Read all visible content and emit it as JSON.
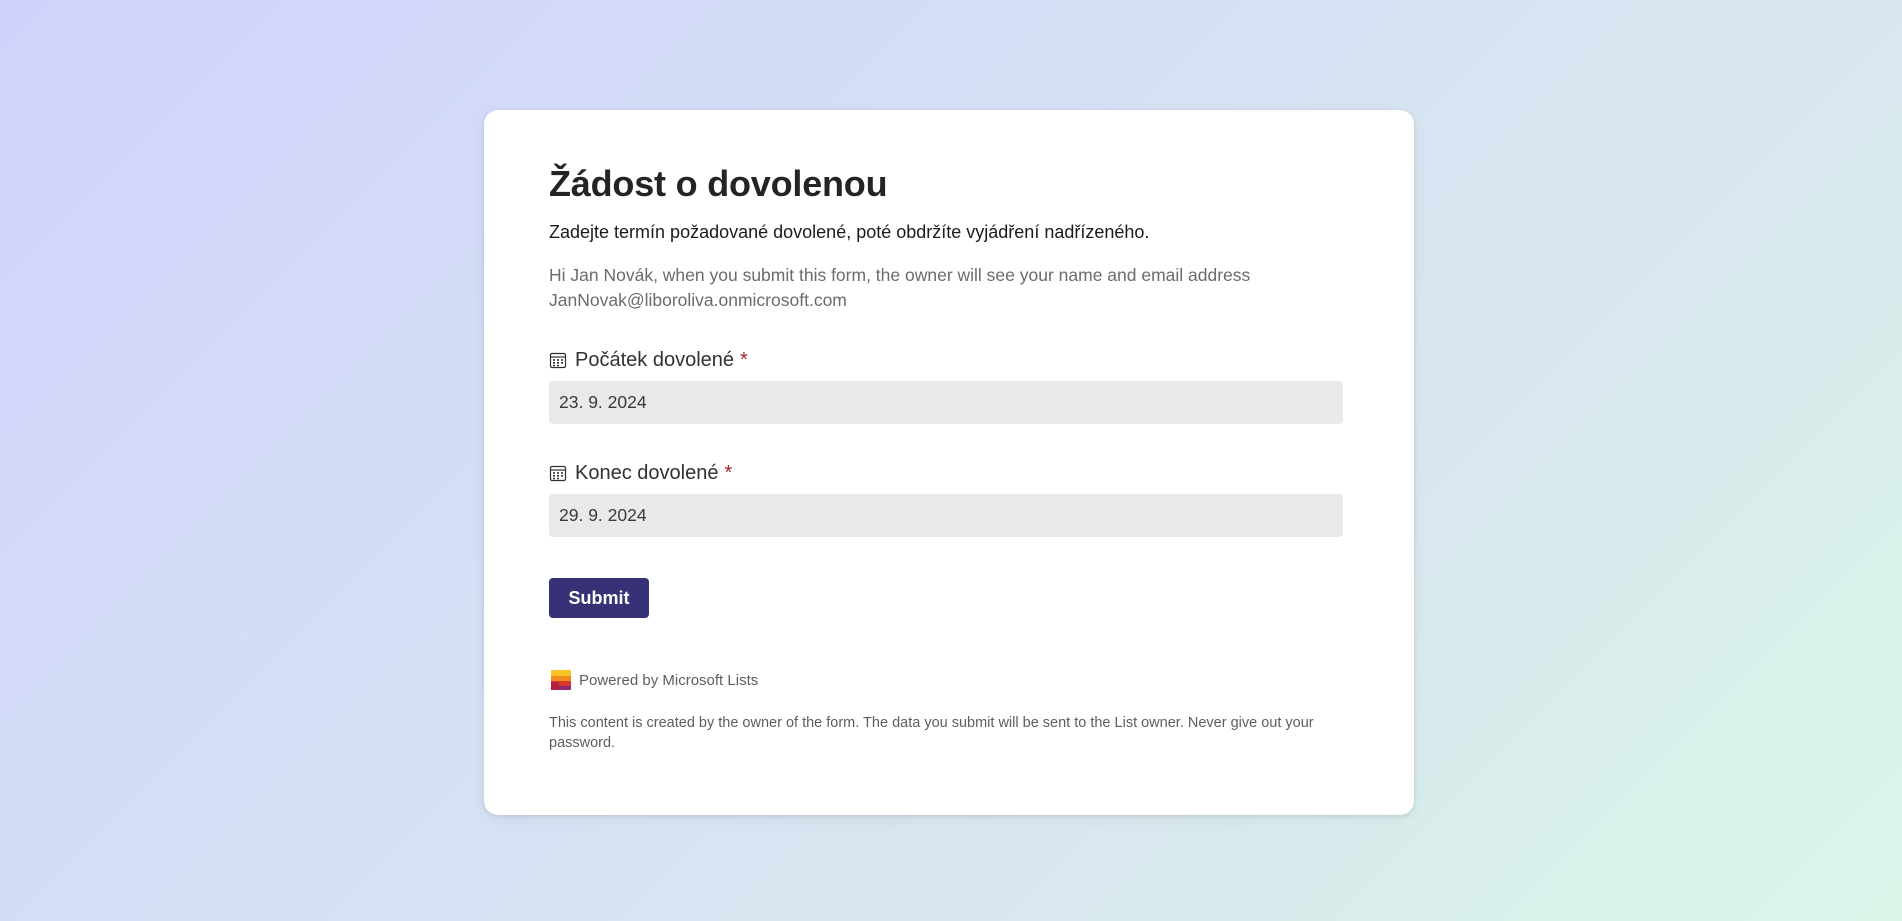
{
  "form": {
    "title": "Žádost o dovolenou",
    "subtitle": "Zadejte termín požadované dovolené, poté obdržíte vyjádření nadřízeného.",
    "notice_line1": "Hi Jan Novák, when you submit this form, the owner will see your name and email address",
    "notice_line2": "JanNovak@liboroliva.onmicrosoft.com",
    "fields": [
      {
        "label": "Počátek dovolené",
        "required_mark": "*",
        "value": "23. 9. 2024",
        "icon": "calendar-icon"
      },
      {
        "label": "Konec dovolené",
        "required_mark": "*",
        "value": "29. 9. 2024",
        "icon": "calendar-icon"
      }
    ],
    "submit_label": "Submit",
    "powered_by": "Powered by Microsoft Lists",
    "powered_icon": "microsoft-lists-logo-icon",
    "disclaimer": "This content is created by the owner of the form. The data you submit will be sent to the List owner. Never give out your password."
  },
  "colors": {
    "accent": "#373277",
    "required": "#a4262c",
    "input_bg": "#eae9e7"
  }
}
